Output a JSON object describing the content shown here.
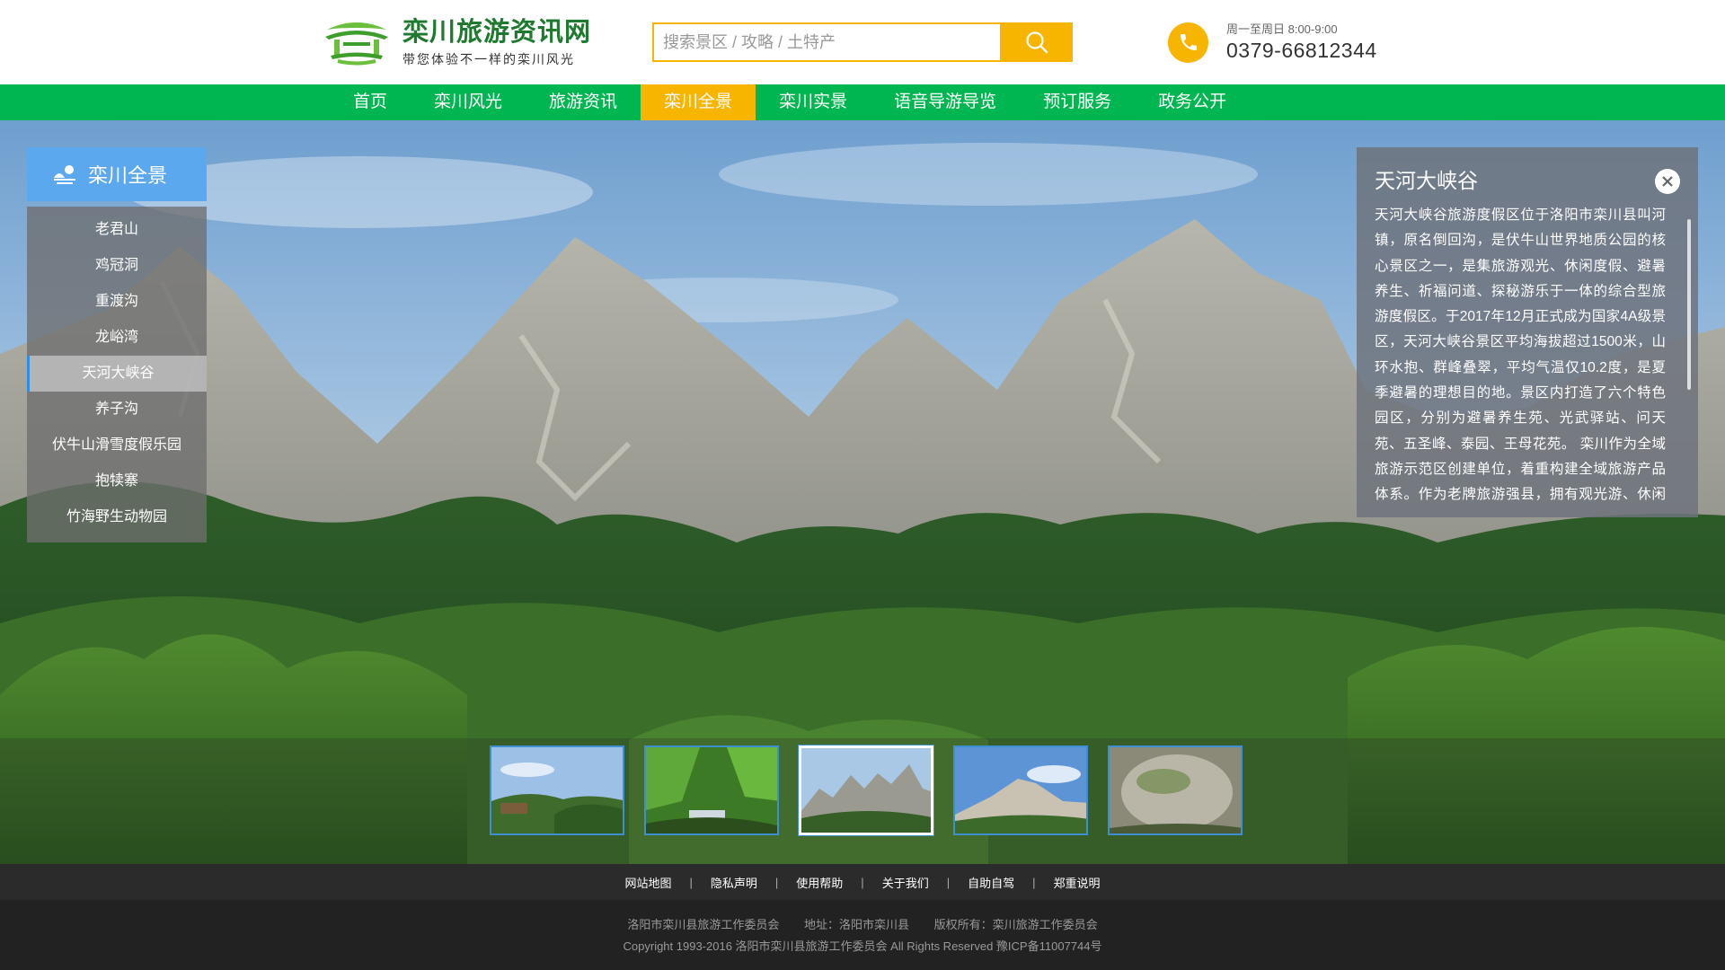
{
  "site": {
    "title": "栾川旅游资讯网",
    "slogan": "带您体验不一样的栾川风光",
    "accent_green": "#00b651",
    "accent_yellow": "#f7b500",
    "logo_icon": "pavilion-logo"
  },
  "search": {
    "placeholder": "搜索景区 / 攻略 / 土特产",
    "button_icon": "search-icon"
  },
  "contact": {
    "hours": "周一至周日  8:00-9:00",
    "phone": "0379-66812344",
    "icon": "phone-icon"
  },
  "nav": {
    "items": [
      {
        "label": "首页"
      },
      {
        "label": "栾川风光"
      },
      {
        "label": "旅游资讯"
      },
      {
        "label": "栾川全景",
        "active": true
      },
      {
        "label": "栾川实景"
      },
      {
        "label": "语音导游导览"
      },
      {
        "label": "预订服务"
      },
      {
        "label": "政务公开"
      }
    ]
  },
  "sidebar": {
    "title": "栾川全景",
    "icon": "landscape-icon",
    "items": [
      {
        "label": "老君山"
      },
      {
        "label": "鸡冠洞"
      },
      {
        "label": "重渡沟"
      },
      {
        "label": "龙峪湾"
      },
      {
        "label": "天河大峡谷",
        "active": true
      },
      {
        "label": "养子沟"
      },
      {
        "label": "伏牛山滑雪度假乐园"
      },
      {
        "label": "抱犊寨"
      },
      {
        "label": "竹海野生动物园"
      }
    ]
  },
  "info": {
    "title": "天河大峡谷",
    "body": "天河大峡谷旅游度假区位于洛阳市栾川县叫河镇，原名倒回沟，是伏牛山世界地质公园的核心景区之一，是集旅游观光、休闲度假、避暑养生、祈福问道、探秘游乐于一体的综合型旅游度假区。于2017年12月正式成为国家4A级景区，天河大峡谷景区平均海拔超过1500米，山环水抱、群峰叠翠，平均气温仅10.2度，是夏季避暑的理想目的地。景区内打造了六个特色园区，分别为避暑养生苑、光武驿站、问天苑、五圣峰、泰园、王母花苑。 栾川作为全域旅游示范区创建单位，着重构建全域旅游产品体系。作为老牌旅游强县，拥有观光游、休闲游、红色游、溶洞游、",
    "close_icon": "close-icon"
  },
  "thumbnails": {
    "active_index": 2,
    "count": 5
  },
  "footer": {
    "links": [
      {
        "label": "网站地图"
      },
      {
        "label": "隐私声明"
      },
      {
        "label": "使用帮助"
      },
      {
        "label": "关于我们"
      },
      {
        "label": "自助自驾"
      },
      {
        "label": "郑重说明"
      }
    ],
    "org": "洛阳市栾川县旅游工作委员会",
    "address": "地址：洛阳市栾川县",
    "rights": "版权所有：栾川旅游工作委员会",
    "copyright": "Copyright 1993-2016 洛阳市栾川县旅游工作委员会 All Rights Reserved 豫ICP备11007744号"
  }
}
